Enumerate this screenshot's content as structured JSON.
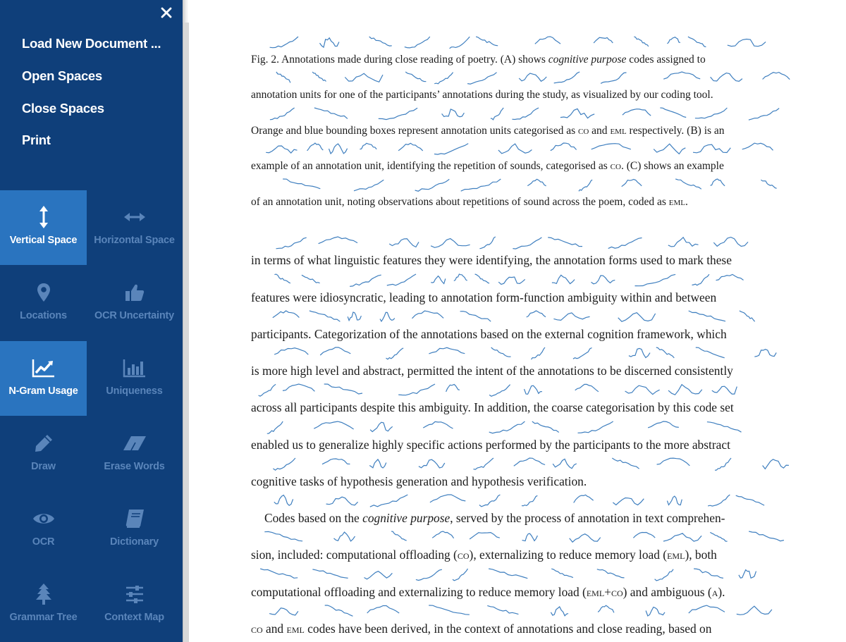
{
  "sidebar": {
    "close_icon": "close-icon",
    "menu": [
      {
        "label": "Load New Document ..."
      },
      {
        "label": "Open Spaces"
      },
      {
        "label": "Close Spaces"
      },
      {
        "label": "Print"
      }
    ],
    "tools": [
      {
        "label": "Vertical Space",
        "icon": "vertical-arrows-icon",
        "active": true
      },
      {
        "label": "Horizontal Space",
        "icon": "horizontal-arrows-icon",
        "active": false
      },
      {
        "label": "Locations",
        "icon": "map-pin-icon",
        "active": false
      },
      {
        "label": "OCR Uncertainty",
        "icon": "thumbs-up-icon",
        "active": false
      },
      {
        "label": "N-Gram Usage",
        "icon": "line-chart-icon",
        "active": true
      },
      {
        "label": "Uniqueness",
        "icon": "bar-chart-icon",
        "active": false
      },
      {
        "label": "Draw",
        "icon": "pencil-icon",
        "active": false
      },
      {
        "label": "Erase Words",
        "icon": "eraser-icon",
        "active": false
      },
      {
        "label": "OCR",
        "icon": "eye-icon",
        "active": false
      },
      {
        "label": "Dictionary",
        "icon": "book-icon",
        "active": false
      },
      {
        "label": "Grammar Tree",
        "icon": "tree-icon",
        "active": false
      },
      {
        "label": "Context Map",
        "icon": "sliders-icon",
        "active": false
      }
    ],
    "colors": {
      "panel": "#0f3f7a",
      "active_tile": "#2a74bf",
      "inactive_label": "#5a85ba"
    }
  },
  "document": {
    "caption": {
      "l1_a": "Fig. 2.  Annotations made during close reading of poetry. (A) shows ",
      "l1_b": "cognitive purpose",
      "l1_c": " codes assigned to",
      "l2": "annotation units for one of the participants’ annotations during the study, as visualized by our coding tool.",
      "l3_a": "Orange and blue bounding boxes represent annotation units categorised as ",
      "l3_b": "co",
      "l3_c": " and ",
      "l3_d": "eml",
      "l3_e": " respectively. (B) is an",
      "l4_a": "example of an annotation unit, identifying the repetition of sounds, categorised as ",
      "l4_b": "co",
      "l4_c": ". (C) shows an example",
      "l5_a": "of an annotation unit, noting observations about repetitions of sound across the poem, coded as ",
      "l5_b": "eml",
      "l5_c": "."
    },
    "body": {
      "l1": "in terms of what linguistic features they were identifying, the annotation forms used to mark these",
      "l2": "features were idiosyncratic, leading to annotation form-function ambiguity within and between",
      "l3": "participants. Categorization of the annotations based on the external cognition framework, which",
      "l4": "is more high level and abstract, permitted the intent of the annotations to be discerned consistently",
      "l5": "across all participants despite this ambiguity. In addition, the coarse categorisation by this code set",
      "l6": "enabled us to generalize highly specific actions performed by the participants to the more abstract",
      "l7": "cognitive tasks of hypothesis generation and hypothesis verification.",
      "l8_a": "Codes based on the ",
      "l8_b": "cognitive purpose",
      "l8_c": ", served by the process of annotation in text comprehen-",
      "l9_a": "sion, included: computational offloading (",
      "l9_b": "co",
      "l9_c": "), externalizing to reduce memory load (",
      "l9_d": "eml",
      "l9_e": "), both",
      "l10_a": "computational offloading and externalizing to reduce memory load (",
      "l10_b": "eml+co",
      "l10_c": ") and ambiguous (",
      "l10_d": "a",
      "l10_e": ").",
      "l11_a": "co",
      "l11_b": " and ",
      "l11_c": "eml",
      "l11_d": " codes have been derived, in the context of annotations and close reading, based on"
    },
    "ngram_color": "#3f7fbf"
  }
}
